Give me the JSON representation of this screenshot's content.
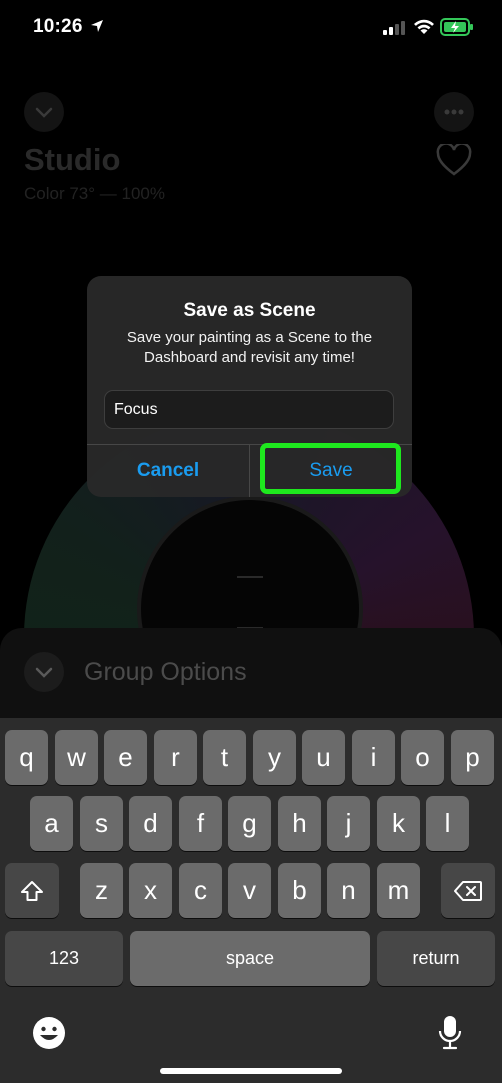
{
  "status_bar": {
    "time": "10:26"
  },
  "background": {
    "room_title": "Studio",
    "room_subtitle": "Color 73° — 100%",
    "group_options_label": "Group Options"
  },
  "alert": {
    "title": "Save as Scene",
    "message": "Save your painting as a Scene to the Dashboard and revisit any time!",
    "input_value": "Focus",
    "cancel_label": "Cancel",
    "save_label": "Save"
  },
  "keyboard": {
    "row1": [
      "q",
      "w",
      "e",
      "r",
      "t",
      "y",
      "u",
      "i",
      "o",
      "p"
    ],
    "row2": [
      "a",
      "s",
      "d",
      "f",
      "g",
      "h",
      "j",
      "k",
      "l"
    ],
    "row3": [
      "z",
      "x",
      "c",
      "v",
      "b",
      "n",
      "m"
    ],
    "numbers_label": "123",
    "space_label": "space",
    "return_label": "return"
  },
  "colors": {
    "accent": "#1a9cf0",
    "highlight": "#1ee81e",
    "key": "#6b6b6b",
    "key_dark": "#474747"
  }
}
